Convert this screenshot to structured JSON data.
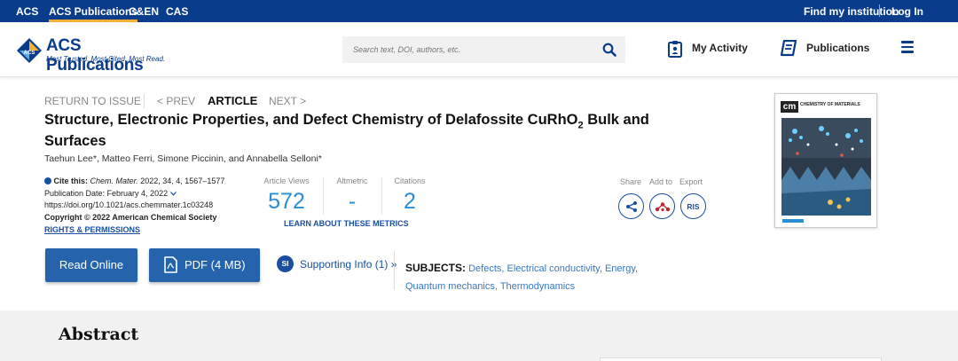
{
  "topbar": {
    "brands": [
      "ACS",
      "ACS Publications",
      "C&EN",
      "CAS"
    ],
    "find_institution": "Find my institution",
    "login": "Log In"
  },
  "header": {
    "logo_name": "ACS Publications",
    "logo_tagline": "Most Trusted. Most Cited. Most Read.",
    "search_placeholder": "Search text, DOI, authors, etc.",
    "my_activity": "My Activity",
    "publications": "Publications"
  },
  "article_nav": {
    "return": "RETURN TO ISSUE",
    "prev": "< PREV",
    "current": "ARTICLE",
    "next": "NEXT >"
  },
  "article": {
    "title_part1": "Structure, Electronic Properties, and Defect Chemistry of Delafossite CuRhO",
    "title_sub": "2",
    "title_part2": " Bulk and",
    "title_line2": "Surfaces",
    "authors": "Taehun Lee*, Matteo Ferri, Simone Piccinin, and Annabella Selloni*",
    "cite_label": "Cite this:",
    "cite_journal": "Chem. Mater.",
    "cite_details": "2022, 34, 4, 1567–1577",
    "pub_date": "Publication Date: February 4, 2022",
    "doi": "https://doi.org/10.1021/acs.chemmater.1c03248",
    "copyright": "Copyright © 2022 American Chemical Society",
    "rights": "RIGHTS & PERMISSIONS"
  },
  "metrics": {
    "views_label": "Article Views",
    "views_value": "572",
    "altmetric_label": "Altmetric",
    "altmetric_value": "-",
    "citations_label": "Citations",
    "citations_value": "2",
    "learn_more": "LEARN ABOUT THESE METRICS"
  },
  "actions": {
    "share_label": "Share",
    "addto_label": "Add to",
    "export_label": "Export",
    "ris": "RIS"
  },
  "cover": {
    "journal_abbr": "cm",
    "journal_name": "CHEMISTRY OF MATERIALS"
  },
  "buttons": {
    "read_online": "Read Online",
    "pdf": "PDF (4 MB)",
    "si_badge": "SI",
    "supporting_info": "Supporting Info (1) »"
  },
  "subjects": {
    "label": "SUBJECTS:",
    "items": [
      "Defects",
      "Electrical conductivity",
      "Energy",
      "Quantum mechanics",
      "Thermodynamics"
    ]
  },
  "abstract": {
    "title": "Abstract"
  },
  "colors": {
    "brand_blue": "#0a3c8c",
    "button_blue": "#2563ad",
    "metric_blue": "#2a8ed6",
    "accent_gold": "#f2b134",
    "altmetric_red": "#c0272d"
  }
}
